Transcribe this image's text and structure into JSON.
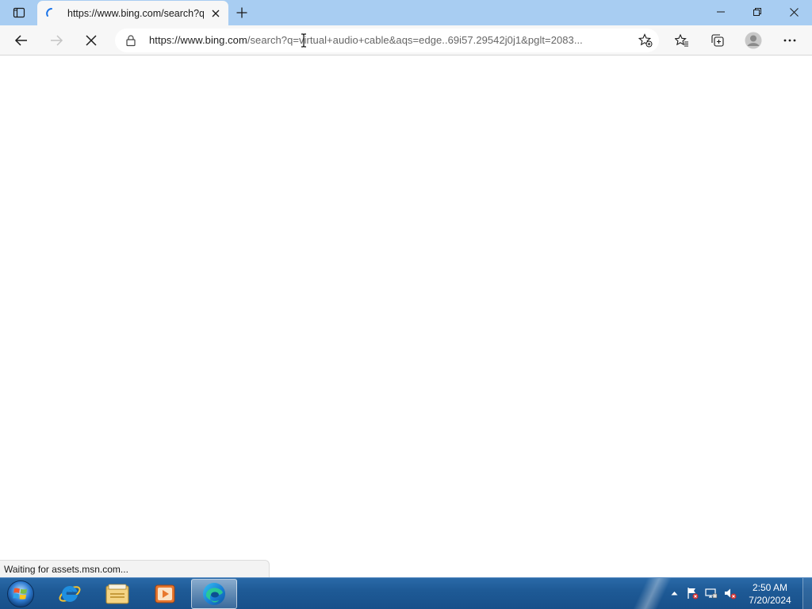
{
  "browser": {
    "tab": {
      "title": "https://www.bing.com/search?q=virtual+audio+cable",
      "state": "loading"
    },
    "address_bar": {
      "url_host": "https://www.bing.com",
      "url_rest": "/search?q=virtual+audio+cable&aqs=edge..69i57.29542j0j1&pglt=2083..."
    },
    "status_text": "Waiting for assets.msn.com..."
  },
  "taskbar": {
    "apps": [
      {
        "name": "internet-explorer"
      },
      {
        "name": "file-explorer"
      },
      {
        "name": "media-player"
      },
      {
        "name": "microsoft-edge",
        "active": true
      }
    ],
    "clock": {
      "time": "2:50 AM",
      "date": "7/20/2024"
    }
  },
  "colors": {
    "tabbar": "#a8cdf2",
    "toolbar": "#f7f7f7",
    "taskbar": "#1e5a96"
  }
}
